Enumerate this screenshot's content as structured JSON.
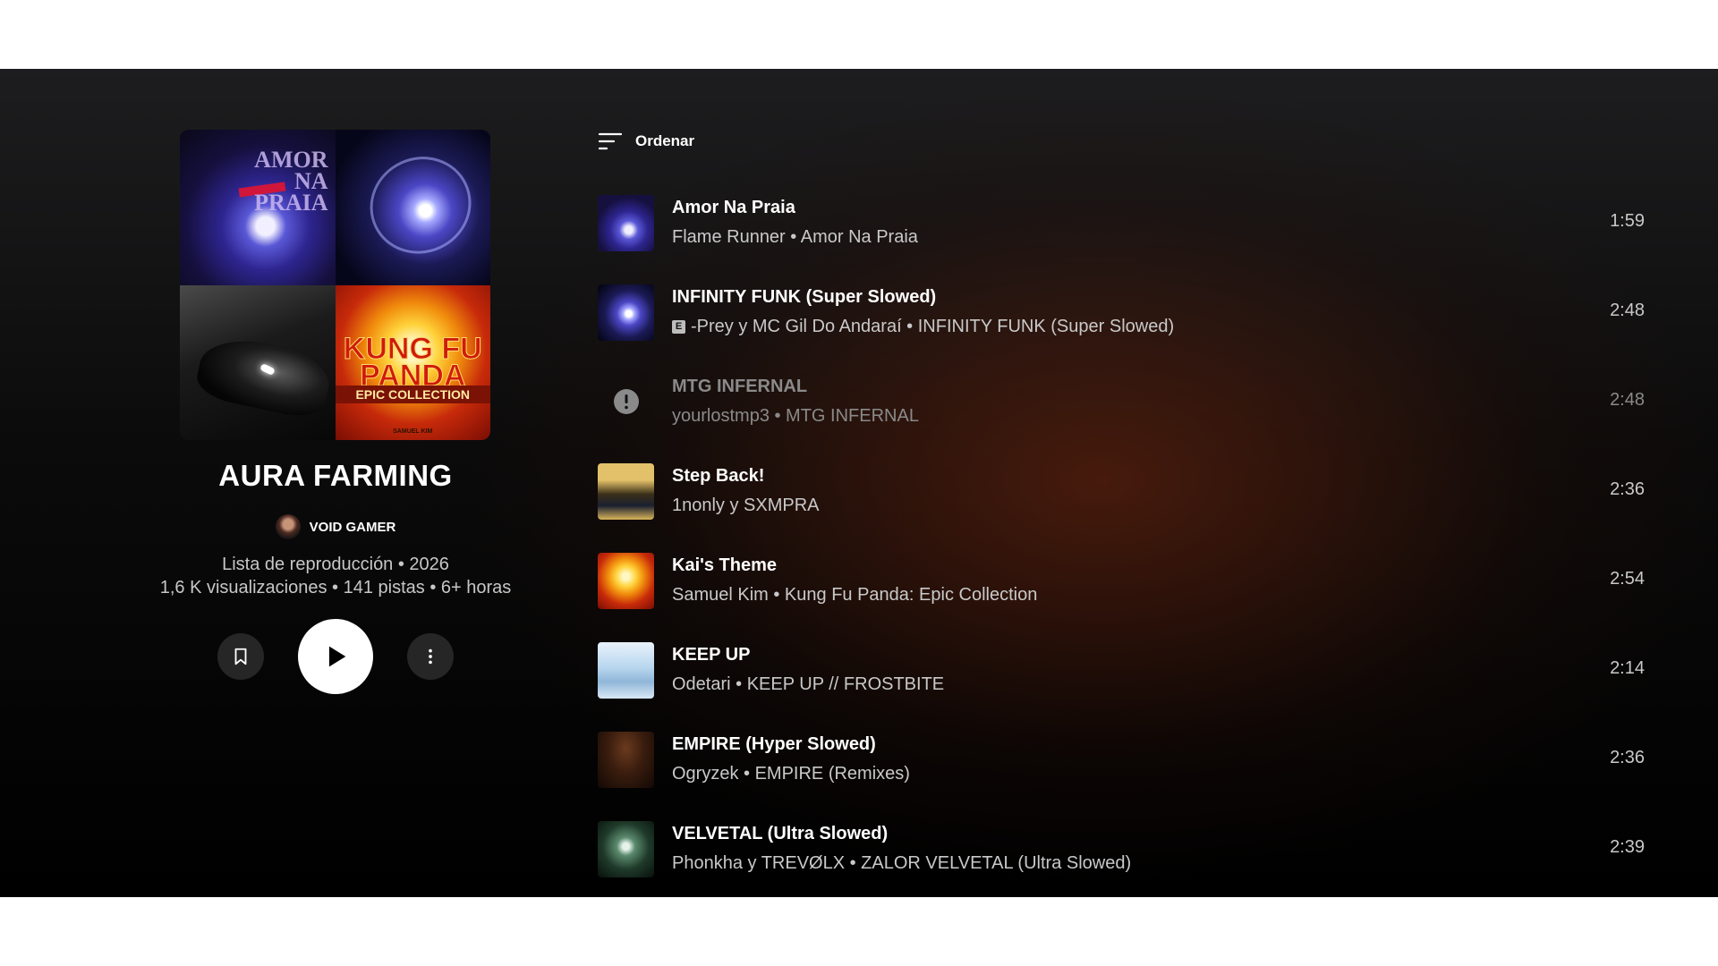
{
  "playlist": {
    "title": "AURA FARMING",
    "owner": "VOID GAMER",
    "meta_line1": "Lista de reproducción • 2026",
    "meta_line2": "1,6 K visualizaciones • 141 pistas • 6+ horas",
    "cover_text": {
      "tile1": "AMOR NA PRAIA",
      "tile4_line1": "KUNG FU PANDA",
      "tile4_line2": "EPIC COLLECTION",
      "tile4_line3": "SAMUEL KIM"
    }
  },
  "controls": {
    "save_icon": "bookmark-icon",
    "play_icon": "play-icon",
    "more_icon": "more-vertical-icon"
  },
  "sort": {
    "label": "Ordenar",
    "icon": "sort-icon"
  },
  "tracks": [
    {
      "title": "Amor Na Praia",
      "subtitle": "Flame Runner • Amor Na Praia",
      "duration": "1:59",
      "explicit": false,
      "unavailable": false
    },
    {
      "title": "INFINITY FUNK (Super Slowed)",
      "subtitle": "-Prey y MC Gil Do Andaraí • INFINITY FUNK (Super Slowed)",
      "duration": "2:48",
      "explicit": true,
      "explicit_badge": "E",
      "unavailable": false
    },
    {
      "title": "MTG INFERNAL",
      "subtitle": "yourlostmp3 • MTG INFERNAL",
      "duration": "2:48",
      "explicit": false,
      "unavailable": true,
      "status_icon": "alert-icon"
    },
    {
      "title": "Step Back!",
      "subtitle": "1nonly y SXMPRA",
      "duration": "2:36",
      "explicit": false,
      "unavailable": false
    },
    {
      "title": "Kai's Theme",
      "subtitle": "Samuel Kim • Kung Fu Panda: Epic Collection",
      "duration": "2:54",
      "explicit": false,
      "unavailable": false
    },
    {
      "title": "KEEP UP",
      "subtitle": "Odetari • KEEP UP // FROSTBITE",
      "duration": "2:14",
      "explicit": false,
      "unavailable": false
    },
    {
      "title": "EMPIRE (Hyper Slowed)",
      "subtitle": "Ogryzek • EMPIRE (Remixes)",
      "duration": "2:36",
      "explicit": false,
      "unavailable": false
    },
    {
      "title": "VELVETAL (Ultra Slowed)",
      "subtitle": "Phonkha y TREVØLX • ZALOR VELVETAL (Ultra Slowed)",
      "duration": "2:39",
      "explicit": false,
      "unavailable": false
    }
  ],
  "colors": {
    "background": "#000000",
    "text_primary": "#ffffff",
    "text_secondary": "#c9c9c9",
    "text_disabled": "#8a8a8a",
    "accent_glow": "#78280e"
  }
}
